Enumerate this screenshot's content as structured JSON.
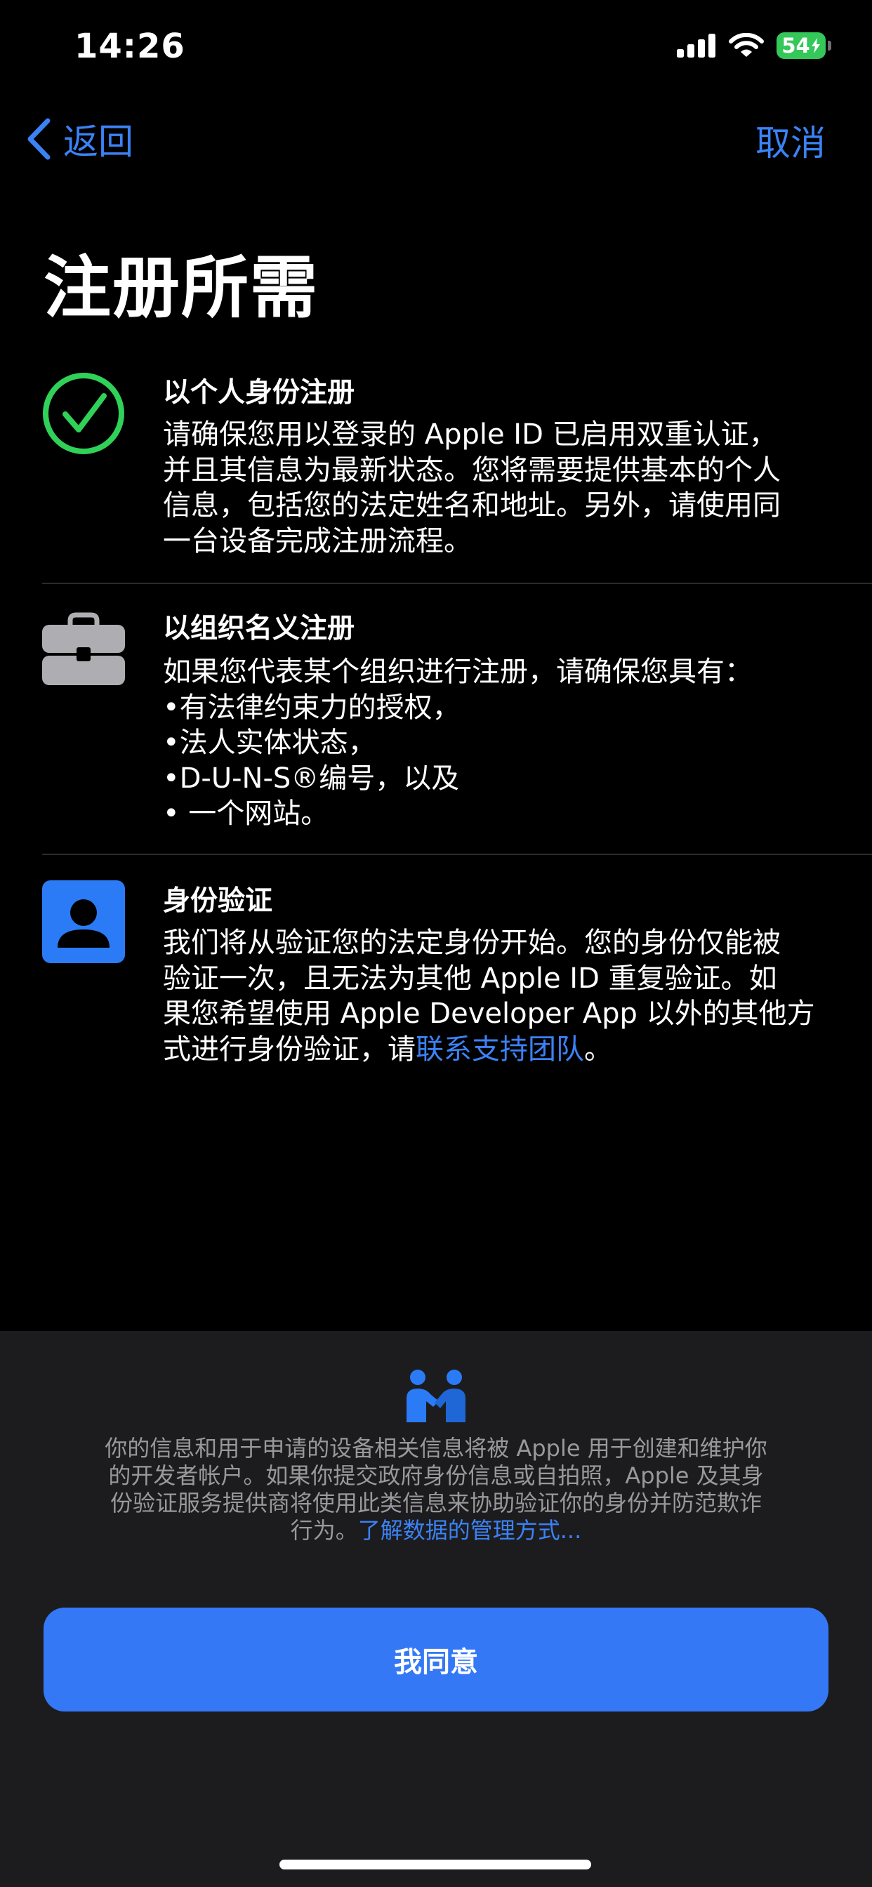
{
  "status": {
    "time": "14:26",
    "battery": "54",
    "icons": [
      "cellular-signal-icon",
      "wifi-icon",
      "battery-charging-icon"
    ]
  },
  "nav": {
    "back_label": "返回",
    "cancel_label": "取消",
    "accent_color": "#3b82f6"
  },
  "page": {
    "title": "注册所需"
  },
  "requirements": [
    {
      "icon": "checkmark-circle-icon",
      "title": "以个人身份注册",
      "lines": [
        "请确保您用以登录的 Apple ID 已启用双重认证，",
        "并且其信息为最新状态。您将需要提供基本的个人",
        "信息，包括您的法定姓名和地址。另外，请使用同",
        "一台设备完成注册流程。"
      ]
    },
    {
      "icon": "briefcase-icon",
      "title": "以组织名义注册",
      "lines": [
        "如果您代表某个组织进行注册，请确保您具有：",
        "•有法律约束力的授权，",
        "•法人实体状态，",
        "•D-U-N-S®编号，以及",
        "• 一个网站。"
      ]
    },
    {
      "icon": "person-id-icon",
      "title": "身份验证",
      "lines": [
        "我们将从验证您的法定身份开始。您的身份仅能被",
        "验证一次，且无法为其他 Apple ID 重复验证。如",
        "果您希望使用 Apple Developer App 以外的其他方"
      ],
      "last_line_prefix": "式进行身份验证，请",
      "support_link": "联系支持团队",
      "last_line_suffix": "。"
    }
  ],
  "footer": {
    "icon": "handshake-icon",
    "privacy_lines": [
      "你的信息和用于申请的设备相关信息将被 Apple 用于创建和维护你",
      "的开发者帐户。如果你提交政府身份信息或自拍照，Apple 及其身",
      "份验证服务提供商将使用此类信息来协助验证你的身份并防范欺诈"
    ],
    "privacy_last_prefix": "行为。",
    "privacy_link": "了解数据的管理方式...",
    "agree_label": "我同意",
    "button_color": "#3478f6"
  }
}
